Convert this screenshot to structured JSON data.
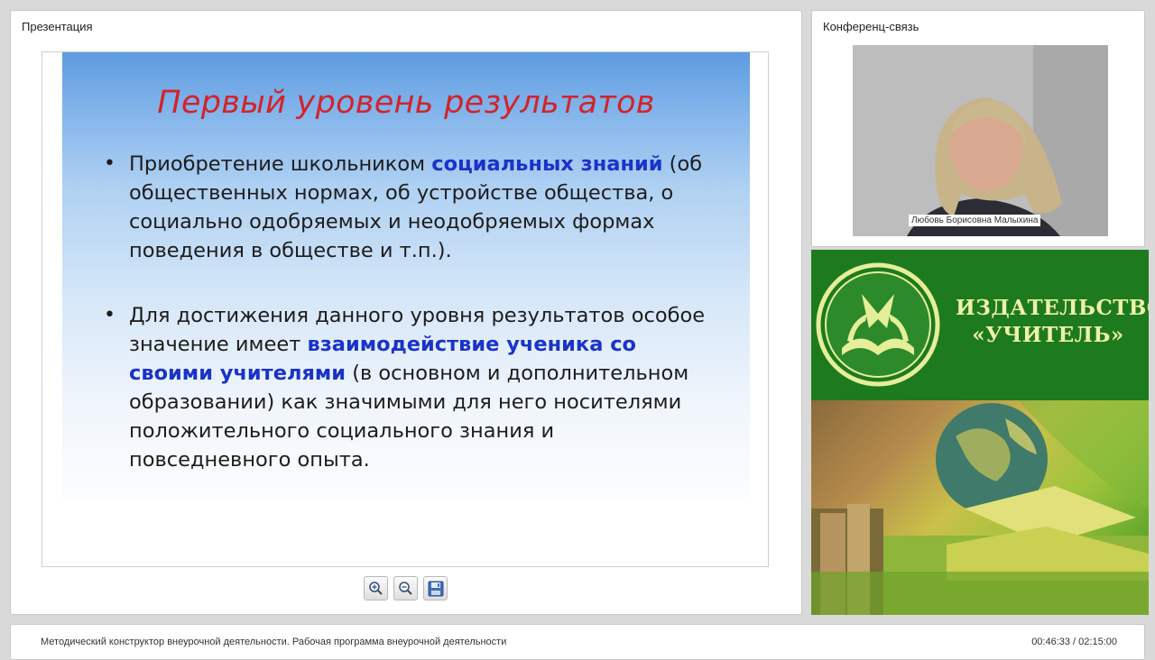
{
  "presentation": {
    "panel_title": "Презентация",
    "slide": {
      "title": "Первый уровень результатов",
      "bullets": [
        {
          "pre": "Приобретение школьником ",
          "highlight": "социальных знаний",
          "post": " (об общественных нормах, об устройстве общества, о социально одобряемых и неодобряемых формах поведения в обществе и т.п.)."
        },
        {
          "pre": "Для достижения данного уровня результатов особое значение имеет ",
          "highlight": "взаимодействие ученика со своими учителями",
          "post": " (в основном и дополнительном образовании) как значимыми для него носителями положительного социального знания и повседневного опыта."
        }
      ]
    },
    "toolbar": {
      "zoom_in_icon": "zoom-in-icon",
      "zoom_out_icon": "zoom-out-icon",
      "save_icon": "floppy-disk-icon"
    }
  },
  "conference": {
    "panel_title": "Конференц-связь",
    "speaker_name": "Любовь Борисовна Малыхина"
  },
  "ad": {
    "publisher_line1": "ИЗДАТЕЛЬСТВО",
    "publisher_line2": "«УЧИТЕЛЬ»"
  },
  "footer": {
    "course_title": "Методический конструктор внеурочной деятельности. Рабочая программа внеурочной деятельности",
    "timer": "00:46:33 / 02:15:00"
  },
  "colors": {
    "slide_title": "#d2232a",
    "highlight": "#1a33c8",
    "ad_green": "#1e7a1e",
    "ad_text": "#eef2a8"
  }
}
